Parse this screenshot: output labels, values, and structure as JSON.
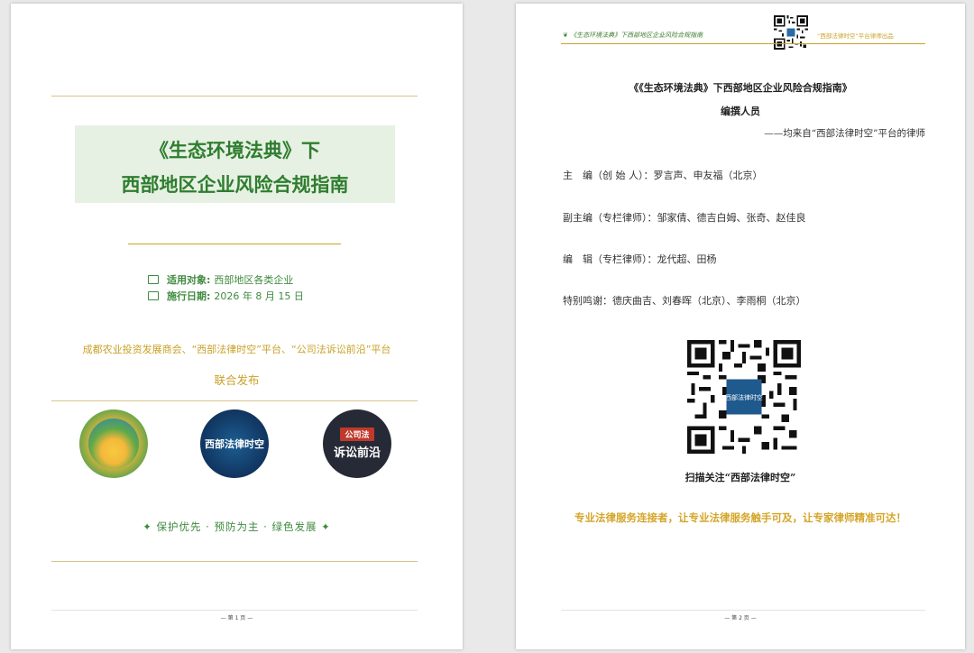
{
  "page1": {
    "title_line1": "《生态环境法典》下",
    "title_line2": "西部地区企业风险合规指南",
    "meta": {
      "audience_label": "适用对象:",
      "audience_value": "西部地区各类企业",
      "date_label": "施行日期:",
      "date_value": "2026 年 8 月 15 日"
    },
    "publishers": "成都农业投资发展商会、“西部法律时空”平台、“公司法诉讼前沿”平台",
    "joint_release": "联合发布",
    "logos": {
      "logo2_text": "西部法律时空",
      "logo3_tag": "公司法",
      "logo3_text": "诉讼前沿"
    },
    "motto": "✦ 保护优先 · 预防为主 · 绿色发展 ✦",
    "page_number": "— 第 1 页 —"
  },
  "page2": {
    "header_left": "《生态环境法典》下西部地区企业风险合规指南",
    "header_right": "“西部法律时空”平台律师出品",
    "title": "《《生态环境法典》下西部地区企业风险合规指南》",
    "editors_heading": "编撰人员",
    "editors_from": "——均来自“西部法律时空”平台的律师",
    "lines": [
      "主　编（创 始 人）：罗言声、申友福（北京）",
      "副主编（专栏律师）：邹家倩、德吉白姆、张奇、赵佳良",
      "编　辑（专栏律师）：龙代超、田杨",
      "特别鸣谢：德庆曲吉、刘春晖（北京）、李雨桐（北京）"
    ],
    "qr_caption": "西部法律时空",
    "scan_text": "扫描关注“西部法律时空”",
    "slogan": "专业法律服务连接者，让专业法律服务触手可及，让专家律师精准可达！",
    "page_number": "— 第 2 页 —"
  },
  "colors": {
    "green": "#2f7d2f",
    "gold": "#c9a227",
    "title_bg": "#e6f1e4"
  }
}
